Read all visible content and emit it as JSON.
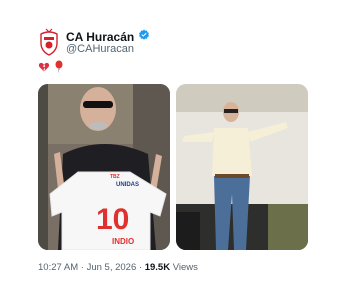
{
  "tweet": {
    "display_name": "CA Huracán",
    "handle": "@CAHuracan",
    "verified_icon": "verified-badge-icon",
    "avatar_icon": "club-crest-icon",
    "body_emojis": [
      "broken-heart-emoji",
      "balloon-emoji"
    ],
    "media": [
      {
        "icon": "photo-man-holding-jersey",
        "jersey_brand": "TBZ",
        "jersey_sponsor": "UNIDAS",
        "jersey_number": "10",
        "jersey_name": "INDIO"
      },
      {
        "icon": "photo-man-performing-on-stage"
      }
    ],
    "time": "10:27 AM",
    "separator": "·",
    "date": "Jun 5, 2026",
    "views_count": "19.5K",
    "views_label": "Views"
  },
  "colors": {
    "verified": "#1d9bf0",
    "crest_red": "#d6202b",
    "jersey_red": "#e0312f",
    "meta_text": "#536471"
  }
}
